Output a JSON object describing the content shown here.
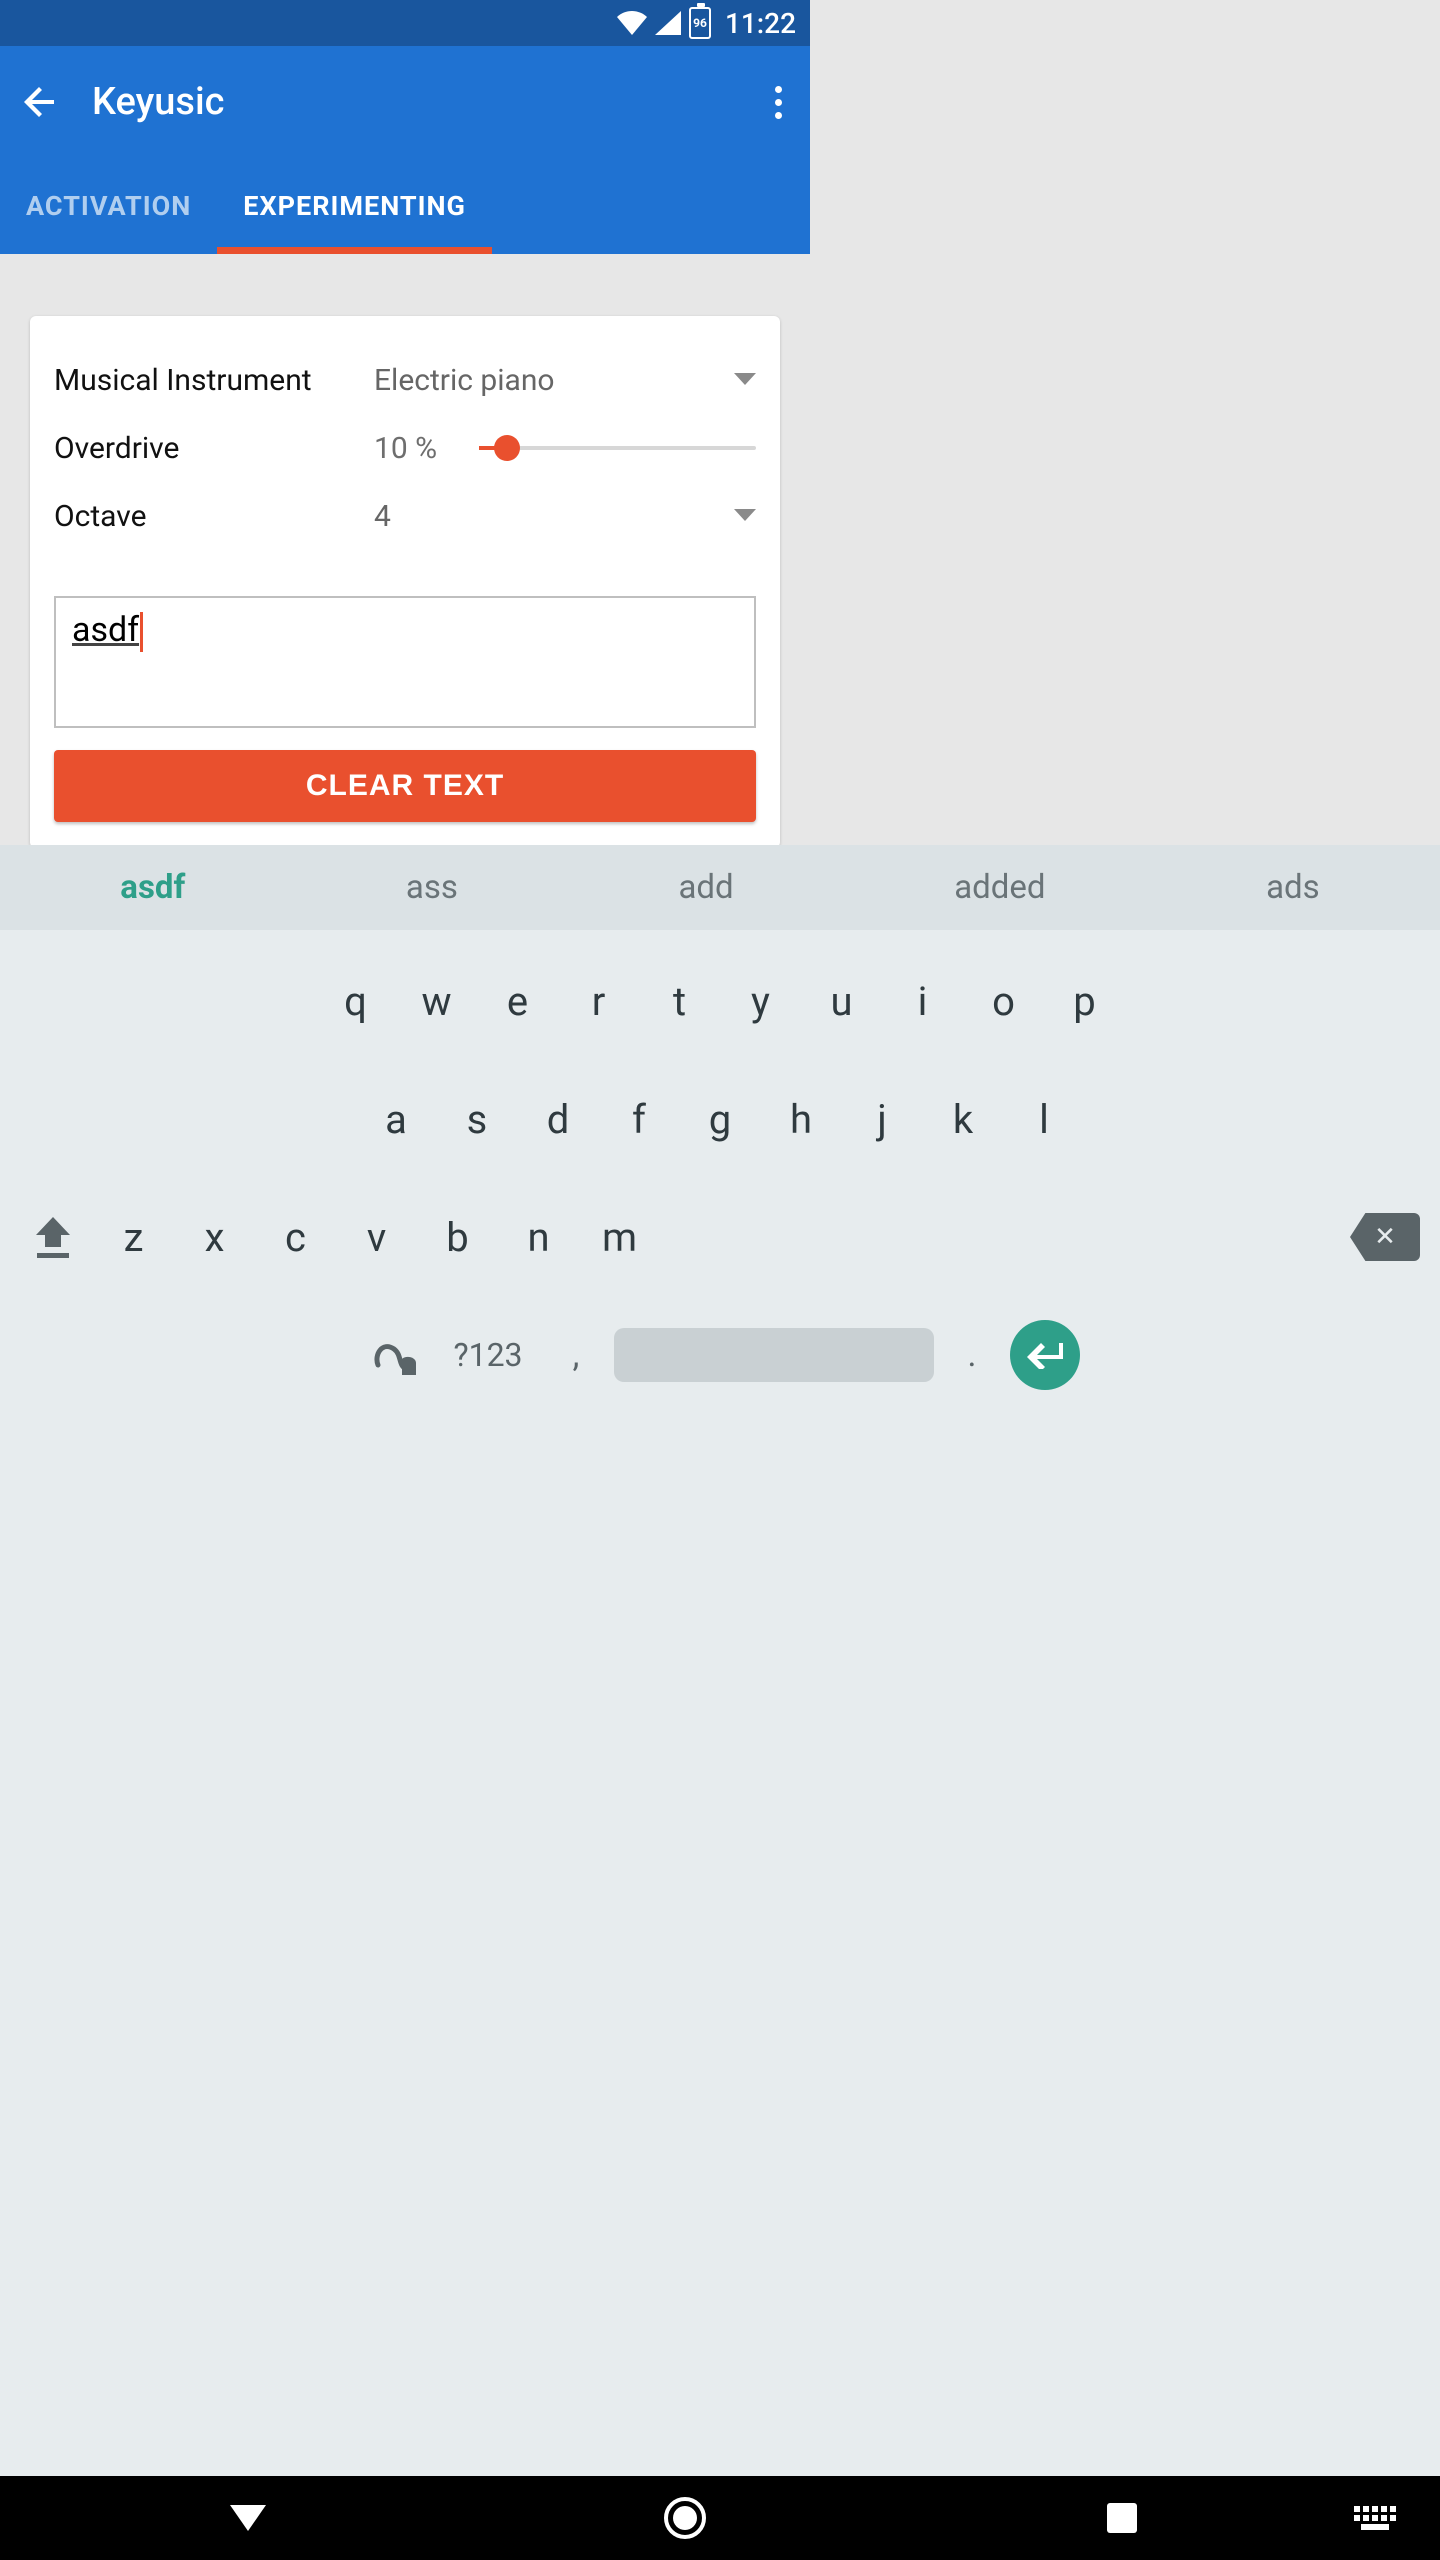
{
  "status": {
    "time": "11:22",
    "battery_level": "96"
  },
  "appbar": {
    "title": "Keyusic"
  },
  "tabs": {
    "activation": "ACTIVATION",
    "experimenting": "EXPERIMENTING",
    "active": "experimenting"
  },
  "settings": {
    "instrument_label": "Musical Instrument",
    "instrument_value": "Electric piano",
    "overdrive_label": "Overdrive",
    "overdrive_value": "10 %",
    "overdrive_percent": 10,
    "octave_label": "Octave",
    "octave_value": "4"
  },
  "textfield": {
    "value": "asdf"
  },
  "buttons": {
    "clear": "CLEAR TEXT"
  },
  "suggestions": [
    "asdf",
    "ass",
    "add",
    "added",
    "ads"
  ],
  "keyboard": {
    "row1": [
      "q",
      "w",
      "e",
      "r",
      "t",
      "y",
      "u",
      "i",
      "o",
      "p"
    ],
    "row2": [
      "a",
      "s",
      "d",
      "f",
      "g",
      "h",
      "j",
      "k",
      "l"
    ],
    "row3": [
      "z",
      "x",
      "c",
      "v",
      "b",
      "n",
      "m"
    ],
    "symbols_label": "?123",
    "comma": ",",
    "period": "."
  }
}
